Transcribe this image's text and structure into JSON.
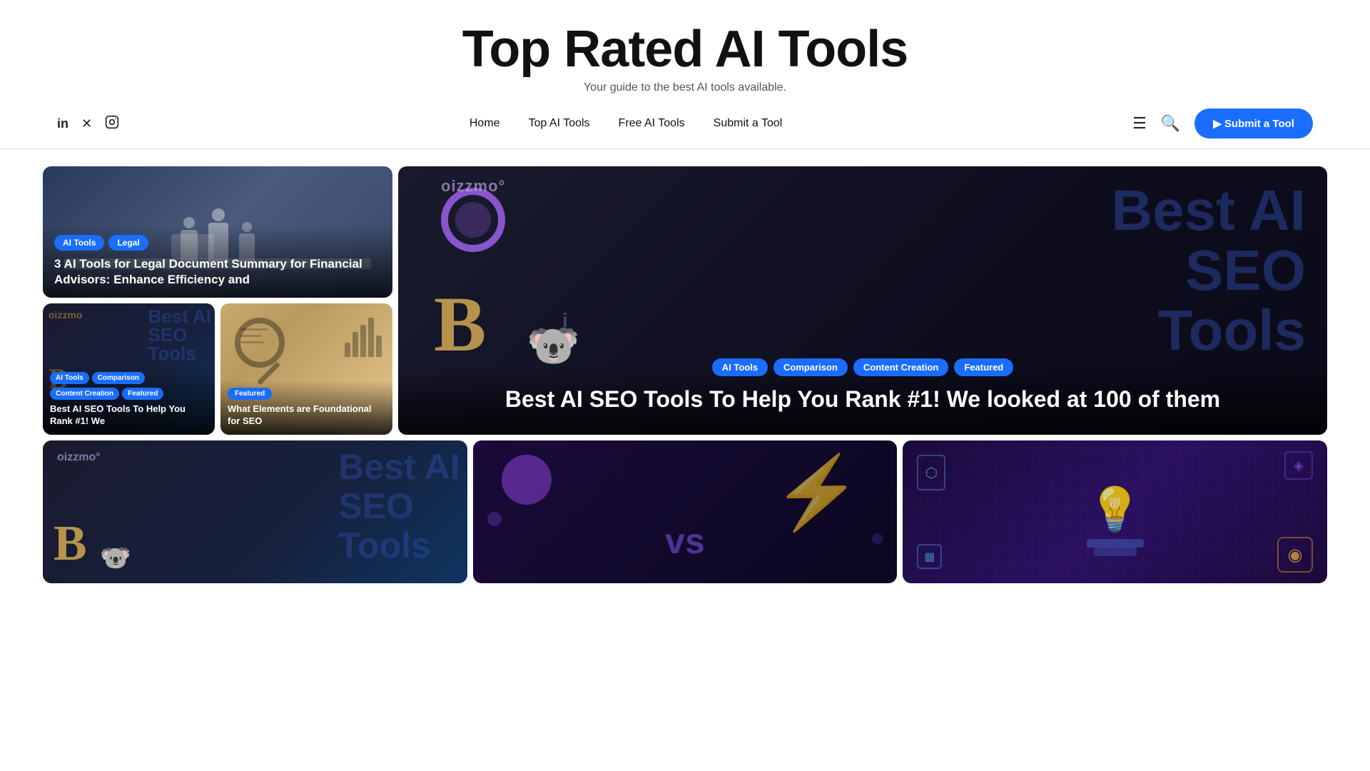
{
  "site": {
    "title": "Top Rated AI Tools",
    "subtitle": "Your guide to the best AI tools available."
  },
  "social": [
    {
      "name": "linkedin",
      "icon": "in",
      "label": "LinkedIn"
    },
    {
      "name": "twitter",
      "icon": "✕",
      "label": "Twitter/X"
    },
    {
      "name": "instagram",
      "icon": "⬡",
      "label": "Instagram"
    }
  ],
  "nav": {
    "links": [
      {
        "id": "home",
        "label": "Home"
      },
      {
        "id": "top-ai-tools",
        "label": "Top AI Tools"
      },
      {
        "id": "free-ai-tools",
        "label": "Free AI Tools"
      },
      {
        "id": "submit-tool",
        "label": "Submit a Tool"
      }
    ],
    "submit_label": "▶ Submit a Tool"
  },
  "featured_cards": {
    "big_left": {
      "tags": [
        "AI Tools",
        "Legal"
      ],
      "title": "3 AI Tools for Legal Document Summary for Financial Advisors: Enhance Efficiency and"
    },
    "small_left": {
      "tags": [
        "AI Tools",
        "Comparison",
        "Content Creation",
        "Featured"
      ],
      "title": "Best AI SEO Tools To Help You Rank #1! We"
    },
    "small_right": {
      "tags": [
        "Featured"
      ],
      "title": "What Elements are Foundational for SEO"
    },
    "big_right": {
      "tags": [
        "AI Tools",
        "Comparison",
        "Content Creation",
        "Featured"
      ],
      "title": "Best AI SEO Tools To Help You Rank #1! We looked at 100 of them"
    }
  },
  "bottom_cards": [
    {
      "id": "seo2",
      "type": "seo"
    },
    {
      "id": "vs",
      "type": "vs"
    },
    {
      "id": "tech",
      "type": "tech"
    }
  ],
  "tags": {
    "ai_tools": "AI Tools",
    "legal": "Legal",
    "comparison": "Comparison",
    "content_creation": "Content Creation",
    "featured": "Featured"
  }
}
